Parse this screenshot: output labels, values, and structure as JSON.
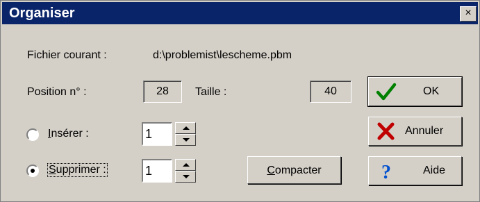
{
  "window": {
    "title": "Organiser",
    "close_glyph": "×"
  },
  "fichier": {
    "label": "Fichier courant :",
    "value": "d:\\problemist\\lescheme.pbm"
  },
  "position": {
    "label": "Position n° :",
    "value": "28"
  },
  "taille": {
    "label": "Taille :",
    "value": "40"
  },
  "inserer": {
    "label": "Insérer :",
    "value": "1",
    "selected": false
  },
  "supprimer": {
    "label": "Supprimer :",
    "value": "1",
    "selected": true
  },
  "buttons": {
    "ok": "OK",
    "annuler": "Annuler",
    "aide": "Aide",
    "compacter": "Compacter"
  },
  "icons": {
    "ok": "check-icon",
    "annuler": "cross-icon",
    "aide": "question-icon"
  },
  "colors": {
    "titlebar": "#0a246a",
    "check": "#008000",
    "cross": "#c00000",
    "question": "#0050d0",
    "dialog": "#d4d0c8"
  }
}
